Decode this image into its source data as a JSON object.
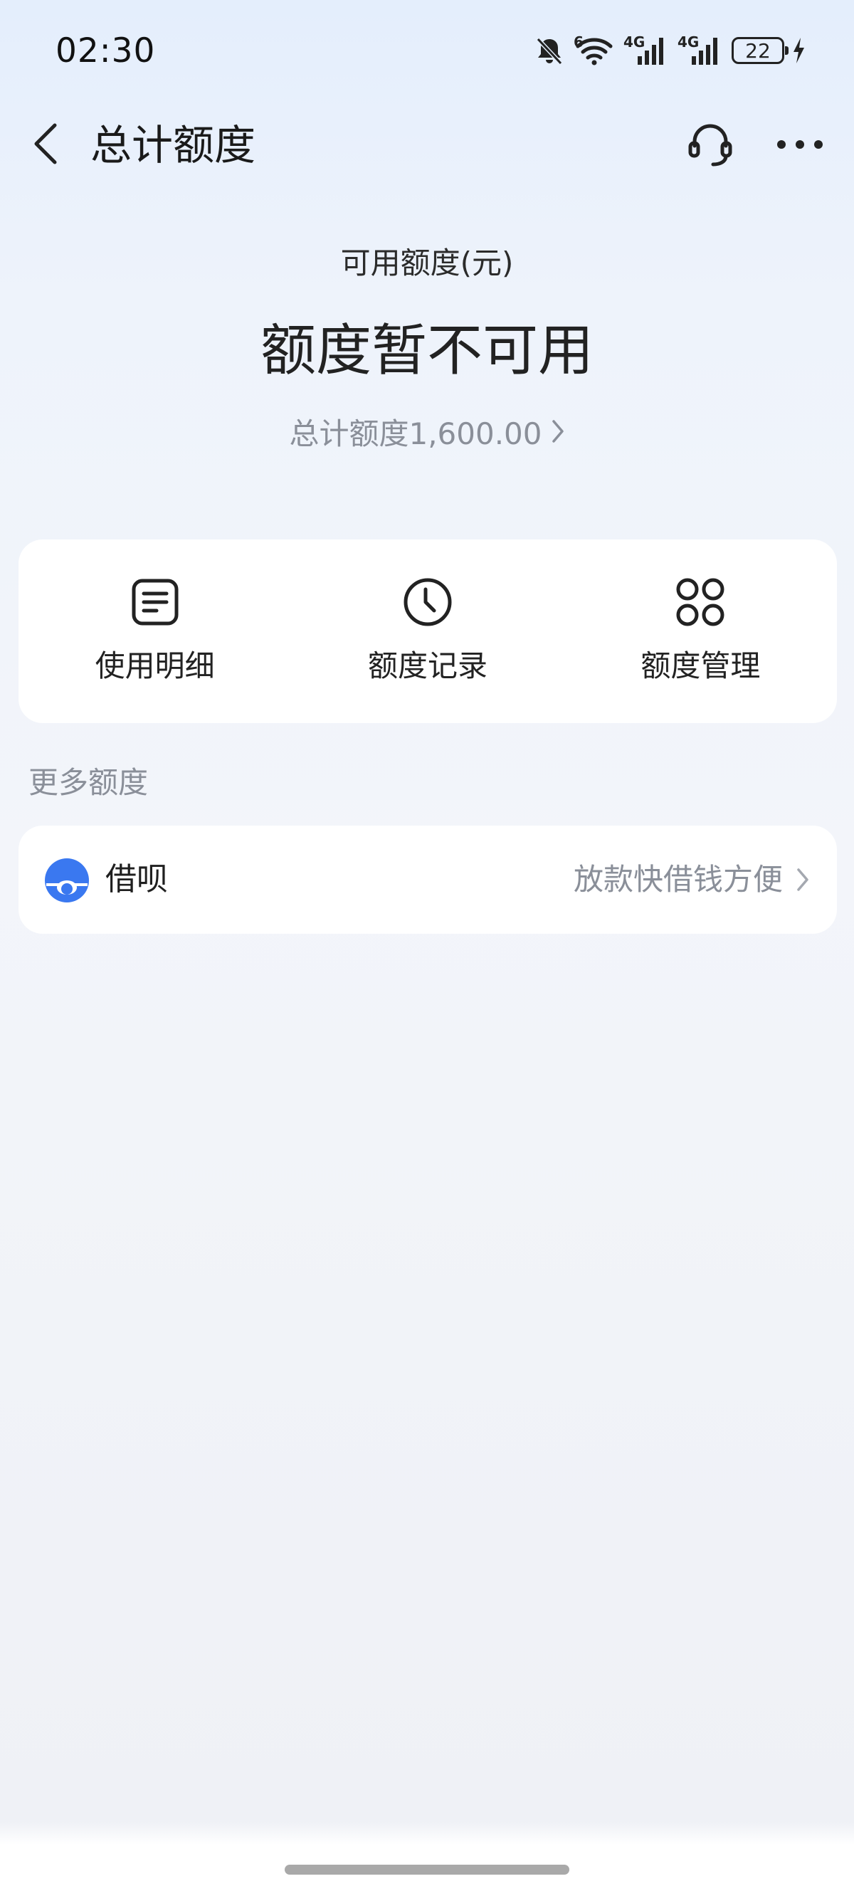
{
  "status_bar": {
    "time": "02:30",
    "network_1": "4G",
    "network_2": "4G",
    "wifi_sup": "6",
    "battery": "22",
    "icons": [
      "mute-bell-icon",
      "wifi-icon",
      "signal-icon",
      "signal-icon",
      "battery-icon",
      "charging-icon"
    ]
  },
  "nav": {
    "title": "总计额度",
    "icons": [
      "back-arrow-icon",
      "headset-icon",
      "more-icon"
    ]
  },
  "summary": {
    "available_label": "可用额度(元)",
    "status_text": "额度暂不可用",
    "total_label": "总计额度1,600.00"
  },
  "actions": [
    {
      "label": "使用明细",
      "icon": "document-icon"
    },
    {
      "label": "额度记录",
      "icon": "clock-icon"
    },
    {
      "label": "额度管理",
      "icon": "grid-icon"
    }
  ],
  "more": {
    "section_title": "更多额度",
    "items": [
      {
        "name": "借呗",
        "desc": "放款快借钱方便",
        "icon": "jiebei-logo-icon"
      }
    ]
  },
  "colors": {
    "accent": "#3a78f0",
    "secondary_text": "#8a8f99",
    "card_bg": "#ffffff"
  }
}
